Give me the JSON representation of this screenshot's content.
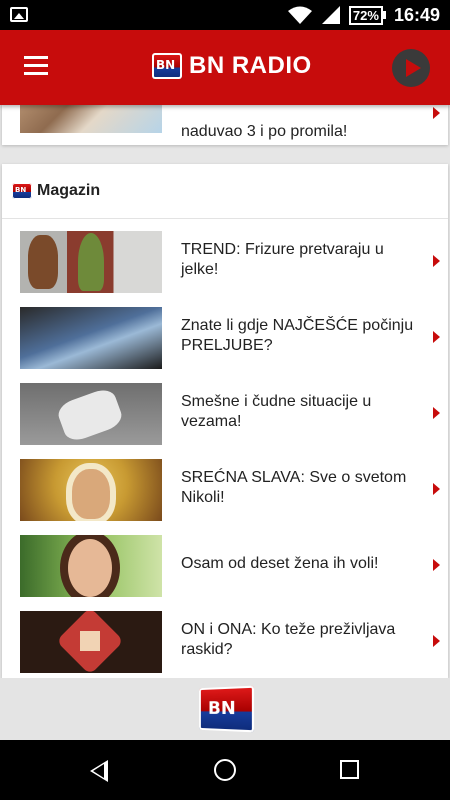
{
  "status_bar": {
    "battery": "72%",
    "time": "16:49",
    "icons": [
      "image-notification-icon",
      "wifi-icon",
      "signal-icon",
      "battery-icon"
    ]
  },
  "app_bar": {
    "title": "BN RADIO",
    "menu_icon": "hamburger-icon",
    "play_icon": "play-icon",
    "accent": "#c70c0c"
  },
  "top_item": {
    "title": "naduvao 3 i po promila!"
  },
  "section": {
    "title": "Magazin",
    "items": [
      {
        "title": "TREND: Frizure pretvaraju u jelke!"
      },
      {
        "title": "Znate li gdje NAJČEŠĆE počinju PRELJUBE?"
      },
      {
        "title": "Smešne i čudne situacije u vezama!"
      },
      {
        "title": "SREĆNA SLAVA: Sve o svetom Nikoli!"
      },
      {
        "title": "Osam od deset žena ih voli!"
      },
      {
        "title": "ON i ONA: Ko teže preživljava raskid?"
      }
    ]
  },
  "nav_bar": {
    "icons": [
      "back-icon",
      "home-icon",
      "recents-icon"
    ]
  }
}
